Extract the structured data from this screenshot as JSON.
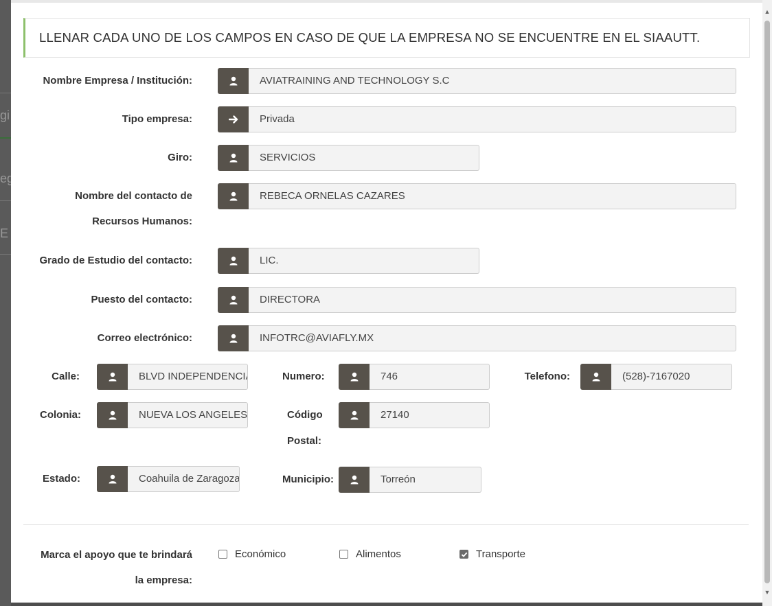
{
  "notice": "LLENAR CADA UNO DE LOS CAMPOS EN CASO DE QUE LA EMPRESA NO SE ENCUENTRE EN EL SIAAUTT.",
  "background_fragments": [
    "gi",
    "eg",
    "E"
  ],
  "fields": {
    "nombre_empresa": {
      "label": "Nombre Empresa / Institución:",
      "value": "AVIATRAINING AND TECHNOLOGY S.C",
      "icon": "user-icon"
    },
    "tipo_empresa": {
      "label": "Tipo empresa:",
      "value": "Privada",
      "icon": "arrow-right-icon"
    },
    "giro": {
      "label": "Giro:",
      "value": "SERVICIOS",
      "icon": "user-icon"
    },
    "contacto_rh": {
      "label_line1": "Nombre del contacto de",
      "label_line2": "Recursos Humanos:",
      "value": "REBECA ORNELAS CAZARES",
      "icon": "user-icon"
    },
    "grado_estudio": {
      "label": "Grado de Estudio del contacto:",
      "value": "LIC.",
      "icon": "user-icon"
    },
    "puesto": {
      "label": "Puesto del contacto:",
      "value": "DIRECTORA",
      "icon": "user-icon"
    },
    "correo": {
      "label": "Correo electrónico:",
      "value": "INFOTRC@AVIAFLY.MX",
      "icon": "user-icon"
    },
    "calle": {
      "label": "Calle:",
      "value": "BLVD INDEPENDENCIA",
      "icon": "user-icon"
    },
    "numero": {
      "label": "Numero:",
      "value": "746",
      "icon": "user-icon"
    },
    "telefono": {
      "label": "Telefono:",
      "value": "(528)-7167020",
      "icon": "user-icon"
    },
    "colonia": {
      "label": "Colonia:",
      "value": "NUEVA LOS ANGELES",
      "icon": "user-icon"
    },
    "codigo_postal": {
      "label_line1": "Código",
      "label_line2": "Postal:",
      "value": "27140",
      "icon": "user-icon"
    },
    "estado": {
      "label": "Estado:",
      "value": "Coahuila de Zaragoza",
      "icon": "user-icon"
    },
    "municipio": {
      "label": "Municipio:",
      "value": "Torreón",
      "icon": "user-icon"
    }
  },
  "apoyo": {
    "label_line1": "Marca el apoyo que te brindará",
    "label_line2": "la empresa:",
    "options": [
      {
        "label": "Económico",
        "checked": false
      },
      {
        "label": "Alimentos",
        "checked": false
      },
      {
        "label": "Transporte",
        "checked": true
      }
    ]
  },
  "colors": {
    "addon": "#57524b",
    "notice_border": "#8dc06b",
    "input_bg": "#f3f3f3"
  }
}
